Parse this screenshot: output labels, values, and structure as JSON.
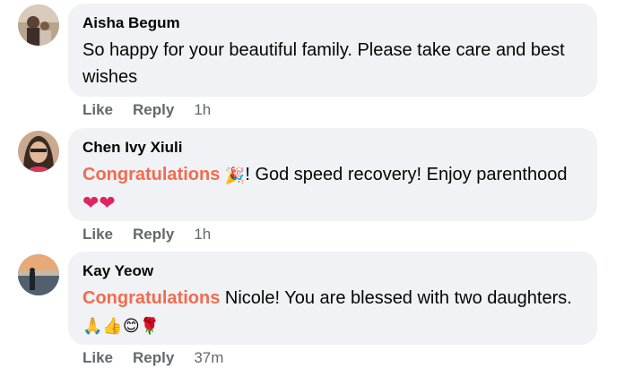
{
  "comments": [
    {
      "author": "Aisha Begum",
      "text": "So happy for your beautiful family. Please take care and best wishes",
      "like_label": "Like",
      "reply_label": "Reply",
      "time": "1h"
    },
    {
      "author": "Chen Ivy Xiuli",
      "highlight": "Congratulations",
      "emoji_party": "🎉",
      "text": "! God speed recovery! Enjoy parenthood",
      "emoji_hearts": "❤❤",
      "like_label": "Like",
      "reply_label": "Reply",
      "time": "1h"
    },
    {
      "author": "Kay Yeow",
      "highlight": "Congratulations",
      "text": " Nicole! You are blessed with two daughters.",
      "emoji_tail": "🙏👍😊🌹",
      "like_label": "Like",
      "reply_label": "Reply",
      "time": "37m"
    }
  ],
  "colors": {
    "bubble_bg": "#f0f2f5",
    "highlight": "#f26b4f",
    "meta_text": "#65676b"
  }
}
